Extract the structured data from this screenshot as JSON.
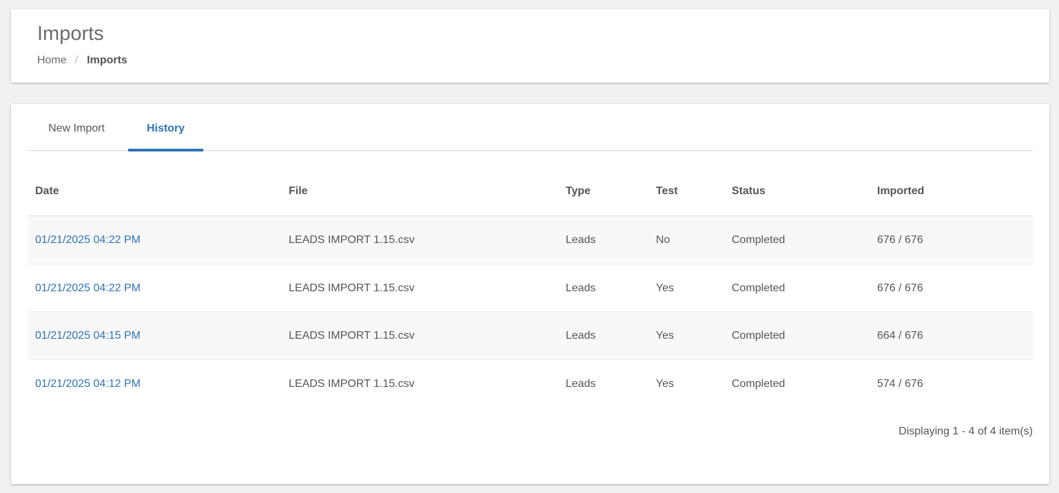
{
  "header": {
    "title": "Imports",
    "breadcrumb": {
      "home": "Home",
      "separator": "/",
      "current": "Imports"
    }
  },
  "tabs": [
    {
      "label": "New Import",
      "active": false
    },
    {
      "label": "History",
      "active": true
    }
  ],
  "table": {
    "columns": [
      "Date",
      "File",
      "Type",
      "Test",
      "Status",
      "Imported"
    ],
    "rows": [
      {
        "date": "01/21/2025 04:22 PM",
        "file": "LEADS IMPORT 1.15.csv",
        "type": "Leads",
        "test": "No",
        "status": "Completed",
        "imported": "676 / 676"
      },
      {
        "date": "01/21/2025 04:22 PM",
        "file": "LEADS IMPORT 1.15.csv",
        "type": "Leads",
        "test": "Yes",
        "status": "Completed",
        "imported": "676 / 676"
      },
      {
        "date": "01/21/2025 04:15 PM",
        "file": "LEADS IMPORT 1.15.csv",
        "type": "Leads",
        "test": "Yes",
        "status": "Completed",
        "imported": "664 / 676"
      },
      {
        "date": "01/21/2025 04:12 PM",
        "file": "LEADS IMPORT 1.15.csv",
        "type": "Leads",
        "test": "Yes",
        "status": "Completed",
        "imported": "574 / 676"
      }
    ]
  },
  "pager": {
    "info": "Displaying 1 - 4 of 4 item(s)"
  },
  "colors": {
    "accent": "#2f73b7",
    "text": "#555555",
    "background": "#f1f1f2"
  }
}
